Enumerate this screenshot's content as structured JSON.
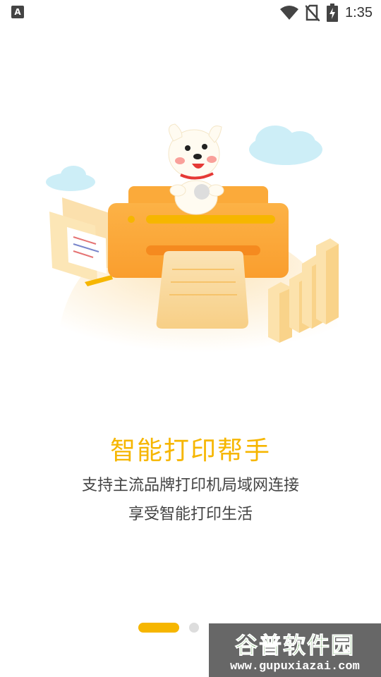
{
  "status_bar": {
    "notification_letter": "A",
    "time": "1:35",
    "icons": [
      "a-notification-icon",
      "wifi-icon",
      "no-sim-icon",
      "battery-charging-icon"
    ]
  },
  "onboarding": {
    "title": "智能打印帮手",
    "subtitle_line1": "支持主流品牌打印机局域网连接",
    "subtitle_line2": "享受智能打印生活",
    "page_count": 2,
    "active_page": 1
  },
  "watermark": {
    "brand": "谷普软件园",
    "url": "www.gupuxiazai.com"
  },
  "colors": {
    "accent": "#F6B600",
    "printer": "#FBAA3A",
    "cloud": "#CDEEF7",
    "text": "#444444"
  }
}
